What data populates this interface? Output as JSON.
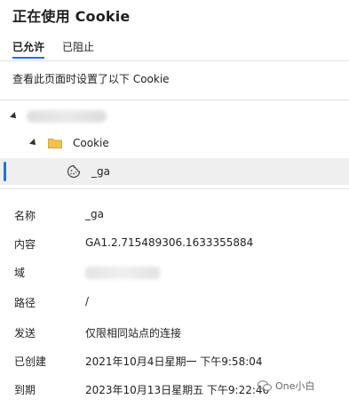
{
  "title": "正在使用 Cookie",
  "tabs": [
    {
      "label": "已允许",
      "active": true
    },
    {
      "label": "已阻止",
      "active": false
    }
  ],
  "description": "查看此页面时设置了以下 Cookie",
  "tree": {
    "folder_label": "Cookie",
    "cookie_name": "_ga"
  },
  "details": {
    "name_key": "名称",
    "name_val": "_ga",
    "content_key": "内容",
    "content_val": "GA1.2.715489306.1633355884",
    "domain_key": "域",
    "path_key": "路径",
    "path_val": "/",
    "send_key": "发送",
    "send_val": "仅限相同站点的连接",
    "created_key": "已创建",
    "created_val": "2021年10月4日星期一 下午9:58:04",
    "expires_key": "到期",
    "expires_val": "2023年10月13日星期五 下午9:22:46"
  },
  "watermark": "One小白",
  "colors": {
    "accent": "#1a73e8",
    "selected_bg": "#efefef",
    "folder": "#f4c24b"
  }
}
